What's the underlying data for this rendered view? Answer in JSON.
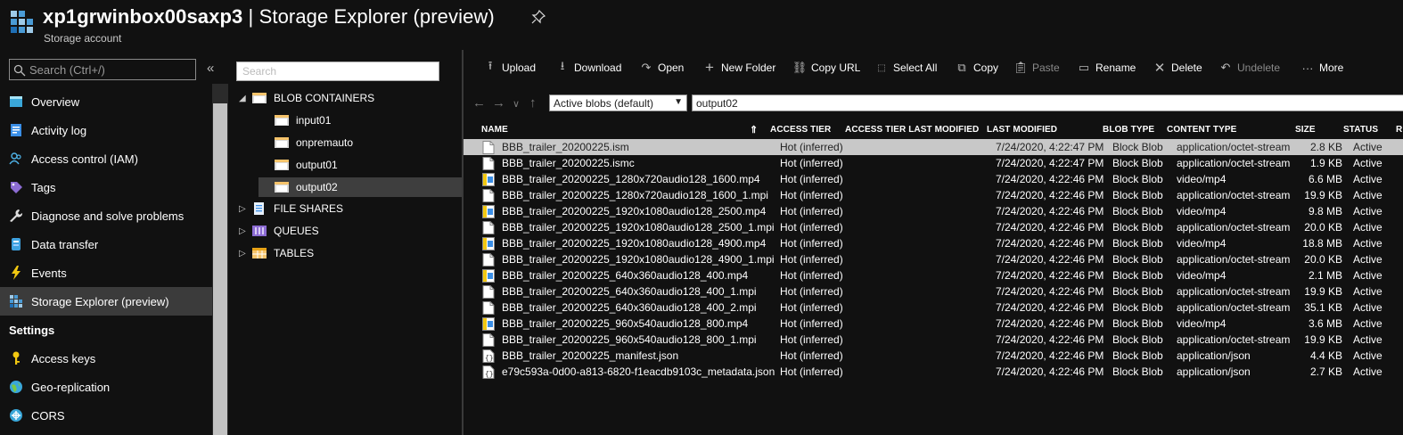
{
  "header": {
    "account_name": "xp1grwinbox00saxp3",
    "separator_title": " | Storage Explorer (preview)",
    "subtitle": "Storage account"
  },
  "nav": {
    "search_placeholder": "Search (Ctrl+/)",
    "collapse_glyph": "«",
    "items": [
      {
        "label": "Overview",
        "icon": "overview-icon"
      },
      {
        "label": "Activity log",
        "icon": "activity-log-icon"
      },
      {
        "label": "Access control (IAM)",
        "icon": "iam-icon"
      },
      {
        "label": "Tags",
        "icon": "tag-icon"
      },
      {
        "label": "Diagnose and solve problems",
        "icon": "wrench-icon"
      },
      {
        "label": "Data transfer",
        "icon": "data-transfer-icon"
      },
      {
        "label": "Events",
        "icon": "lightning-icon"
      },
      {
        "label": "Storage Explorer (preview)",
        "icon": "storage-explorer-icon",
        "active": true
      }
    ],
    "settings_label": "Settings",
    "settings_items": [
      {
        "label": "Access keys",
        "icon": "key-icon"
      },
      {
        "label": "Geo-replication",
        "icon": "globe-icon"
      },
      {
        "label": "CORS",
        "icon": "cors-icon"
      }
    ]
  },
  "tree": {
    "search_placeholder": "Search",
    "blob_containers": "BLOB CONTAINERS",
    "containers": [
      "input01",
      "onpremauto",
      "output01",
      "output02"
    ],
    "selected_container": "output02",
    "file_shares": "FILE SHARES",
    "queues": "QUEUES",
    "tables": "TABLES"
  },
  "toolbar": {
    "upload": "Upload",
    "download": "Download",
    "open": "Open",
    "new_folder": "New Folder",
    "copy_url": "Copy URL",
    "select_all": "Select All",
    "copy": "Copy",
    "paste": "Paste",
    "rename": "Rename",
    "delete": "Delete",
    "undelete": "Undelete",
    "more": "More"
  },
  "address": {
    "view_option": "Active blobs (default)",
    "path": "output02"
  },
  "grid": {
    "columns": {
      "name": "NAME",
      "access_tier": "ACCESS TIER",
      "access_tier_last_modified": "ACCESS TIER LAST MODIFIED",
      "last_modified": "LAST MODIFIED",
      "blob_type": "BLOB TYPE",
      "content_type": "CONTENT TYPE",
      "size": "SIZE",
      "status": "STATUS",
      "r": "R"
    },
    "rows": [
      {
        "name": "BBB_trailer_20200225.ism",
        "kind": "file",
        "tier": "Hot (inferred)",
        "modified": "7/24/2020, 4:22:47 PM",
        "blob_type": "Block Blob",
        "content_type": "application/octet-stream",
        "size": "2.8 KB",
        "status": "Active",
        "selected": true
      },
      {
        "name": "BBB_trailer_20200225.ismc",
        "kind": "file",
        "tier": "Hot (inferred)",
        "modified": "7/24/2020, 4:22:47 PM",
        "blob_type": "Block Blob",
        "content_type": "application/octet-stream",
        "size": "1.9 KB",
        "status": "Active"
      },
      {
        "name": "BBB_trailer_20200225_1280x720audio128_1600.mp4",
        "kind": "video",
        "tier": "Hot (inferred)",
        "modified": "7/24/2020, 4:22:46 PM",
        "blob_type": "Block Blob",
        "content_type": "video/mp4",
        "size": "6.6 MB",
        "status": "Active"
      },
      {
        "name": "BBB_trailer_20200225_1280x720audio128_1600_1.mpi",
        "kind": "file",
        "tier": "Hot (inferred)",
        "modified": "7/24/2020, 4:22:46 PM",
        "blob_type": "Block Blob",
        "content_type": "application/octet-stream",
        "size": "19.9 KB",
        "status": "Active"
      },
      {
        "name": "BBB_trailer_20200225_1920x1080audio128_2500.mp4",
        "kind": "video",
        "tier": "Hot (inferred)",
        "modified": "7/24/2020, 4:22:46 PM",
        "blob_type": "Block Blob",
        "content_type": "video/mp4",
        "size": "9.8 MB",
        "status": "Active"
      },
      {
        "name": "BBB_trailer_20200225_1920x1080audio128_2500_1.mpi",
        "kind": "file",
        "tier": "Hot (inferred)",
        "modified": "7/24/2020, 4:22:46 PM",
        "blob_type": "Block Blob",
        "content_type": "application/octet-stream",
        "size": "20.0 KB",
        "status": "Active"
      },
      {
        "name": "BBB_trailer_20200225_1920x1080audio128_4900.mp4",
        "kind": "video",
        "tier": "Hot (inferred)",
        "modified": "7/24/2020, 4:22:46 PM",
        "blob_type": "Block Blob",
        "content_type": "video/mp4",
        "size": "18.8 MB",
        "status": "Active"
      },
      {
        "name": "BBB_trailer_20200225_1920x1080audio128_4900_1.mpi",
        "kind": "file",
        "tier": "Hot (inferred)",
        "modified": "7/24/2020, 4:22:46 PM",
        "blob_type": "Block Blob",
        "content_type": "application/octet-stream",
        "size": "20.0 KB",
        "status": "Active"
      },
      {
        "name": "BBB_trailer_20200225_640x360audio128_400.mp4",
        "kind": "video",
        "tier": "Hot (inferred)",
        "modified": "7/24/2020, 4:22:46 PM",
        "blob_type": "Block Blob",
        "content_type": "video/mp4",
        "size": "2.1 MB",
        "status": "Active"
      },
      {
        "name": "BBB_trailer_20200225_640x360audio128_400_1.mpi",
        "kind": "file",
        "tier": "Hot (inferred)",
        "modified": "7/24/2020, 4:22:46 PM",
        "blob_type": "Block Blob",
        "content_type": "application/octet-stream",
        "size": "19.9 KB",
        "status": "Active"
      },
      {
        "name": "BBB_trailer_20200225_640x360audio128_400_2.mpi",
        "kind": "file",
        "tier": "Hot (inferred)",
        "modified": "7/24/2020, 4:22:46 PM",
        "blob_type": "Block Blob",
        "content_type": "application/octet-stream",
        "size": "35.1 KB",
        "status": "Active"
      },
      {
        "name": "BBB_trailer_20200225_960x540audio128_800.mp4",
        "kind": "video",
        "tier": "Hot (inferred)",
        "modified": "7/24/2020, 4:22:46 PM",
        "blob_type": "Block Blob",
        "content_type": "video/mp4",
        "size": "3.6 MB",
        "status": "Active"
      },
      {
        "name": "BBB_trailer_20200225_960x540audio128_800_1.mpi",
        "kind": "file",
        "tier": "Hot (inferred)",
        "modified": "7/24/2020, 4:22:46 PM",
        "blob_type": "Block Blob",
        "content_type": "application/octet-stream",
        "size": "19.9 KB",
        "status": "Active"
      },
      {
        "name": "BBB_trailer_20200225_manifest.json",
        "kind": "json",
        "tier": "Hot (inferred)",
        "modified": "7/24/2020, 4:22:46 PM",
        "blob_type": "Block Blob",
        "content_type": "application/json",
        "size": "4.4 KB",
        "status": "Active"
      },
      {
        "name": "e79c593a-0d00-a813-6820-f1eacdb9103c_metadata.json",
        "kind": "json",
        "tier": "Hot (inferred)",
        "modified": "7/24/2020, 4:22:46 PM",
        "blob_type": "Block Blob",
        "content_type": "application/json",
        "size": "2.7 KB",
        "status": "Active"
      }
    ]
  }
}
